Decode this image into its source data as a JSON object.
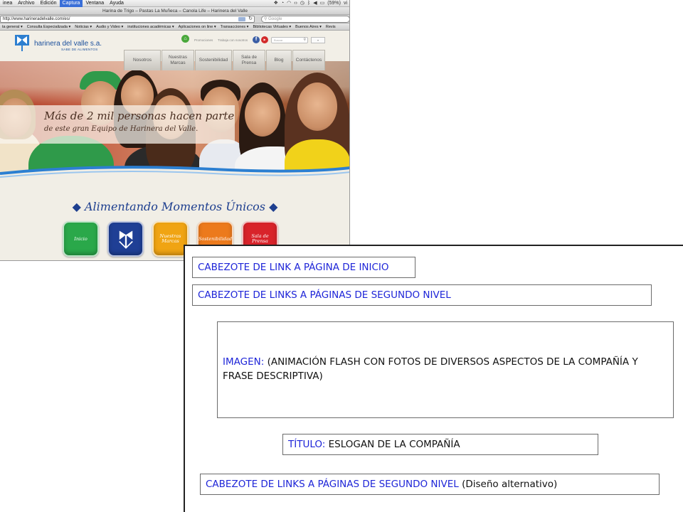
{
  "browser": {
    "menubar": {
      "items": [
        "inea",
        "Archivo",
        "Edición",
        "Captura",
        "Ventana",
        "Ayuda"
      ],
      "active": "Captura",
      "battery": "(59%)",
      "extra": "vi"
    },
    "window_title": "Harina de Trigo – Pastas La Muñeca – Canola Life – Harinera del Valle",
    "url": "http://www.harineradelvalle.com/es/",
    "search_placeholder": "Google",
    "bookmarks": [
      "ta general ▾",
      "Consulta Especializada ▾",
      "Noticias ▾",
      "Audio y Video ▾",
      "instituciones académicas ▾",
      "Aplicaciones on line ▾",
      "Transacciones ▾",
      "Bibliotecas Virtuales ▾",
      "Buenos Aires ▾",
      "Revis"
    ]
  },
  "site": {
    "logo_name": "harinera del valle s.a.",
    "logo_tagline": "SABE DE ALIMENTOS",
    "top_links": [
      "Promociones",
      "Trabaja con nosotros"
    ],
    "site_search_placeholder": "Buscar",
    "nav": [
      "Nosotros",
      "Nuestras Marcas",
      "Sostenibilidad",
      "Sala de Prensa",
      "Blog",
      "Contáctenos"
    ],
    "hero_line1": "Más de 2 mil personas hacen parte",
    "hero_line2": "de este gran Equipo de Harinera del Valle.",
    "slogan": "◆ Alimentando Momentos Únicos ◆",
    "tiles": [
      {
        "label": "Inicio",
        "color": "#2aa84a"
      },
      {
        "label": "",
        "color": "#1f3f95"
      },
      {
        "label": "Nuestras Marcas",
        "color": "#f0a413"
      },
      {
        "label": "Sostenibilidad",
        "color": "#ec7a1c"
      },
      {
        "label": "Sala de Prensa",
        "color": "#d8232a"
      }
    ]
  },
  "annotations": {
    "home_header": "CABEZOTE DE LINK A PÁGINA DE INICIO",
    "second_level_header": "CABEZOTE DE LINKS A PÁGINAS DE SEGUNDO NIVEL",
    "image_label": "IMAGEN:",
    "image_desc": "(ANIMACIÓN FLASH CON FOTOS DE DIVERSOS ASPECTOS DE LA COMPAÑÍA Y FRASE DESCRIPTIVA)",
    "title_label": "TÍTULO:",
    "title_desc": "ESLOGAN DE LA COMPAÑÍA",
    "alt_header": "CABEZOTE DE LINKS A PÁGINAS DE SEGUNDO NIVEL",
    "alt_note": "(Diseño alternativo)"
  }
}
